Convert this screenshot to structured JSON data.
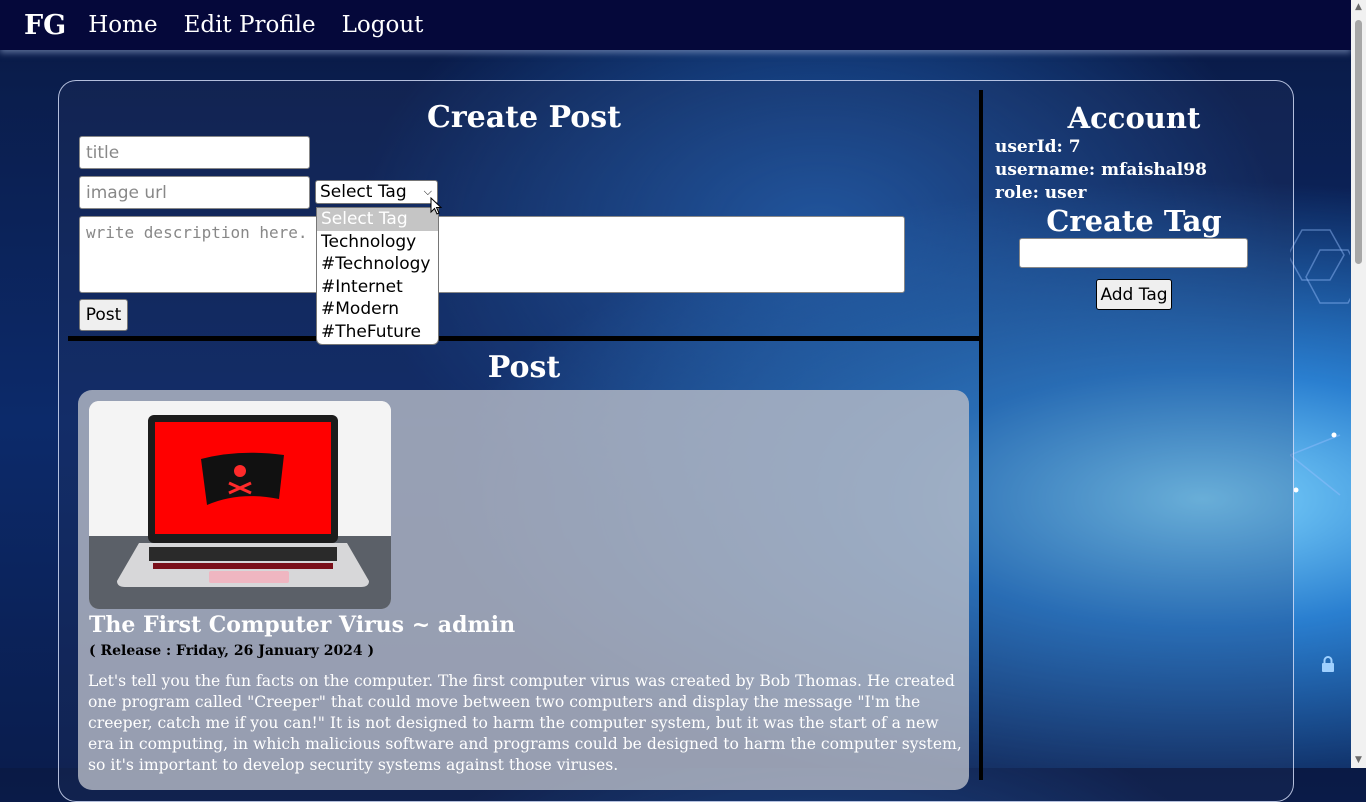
{
  "nav": {
    "brand": "FG",
    "links": [
      "Home",
      "Edit Profile",
      "Logout"
    ]
  },
  "create_post": {
    "title": "Create Post",
    "title_placeholder": "title",
    "image_placeholder": "image url",
    "description_placeholder": "write description here.",
    "tag_select": {
      "selected": "Select Tag",
      "options": [
        "Select Tag",
        "Technology",
        "#Technology",
        "#Internet",
        "#Modern",
        "#TheFuture"
      ]
    },
    "post_button": "Post"
  },
  "post_section": {
    "title": "Post",
    "post": {
      "heading": "The First Computer Virus ~ admin",
      "release": "( Release : Friday, 26 January 2024 )",
      "body": "Let's tell you the fun facts on the computer. The first computer virus was created by Bob Thomas. He created one program called \"Creeper\" that could move between two computers and display the message \"I'm the creeper, catch me if you can!\" It is not designed to harm the computer system, but it was the start of a new era in computing, in which malicious software and programs could be designed to harm the computer system, so it's important to develop security systems against those viruses."
    }
  },
  "account": {
    "title": "Account",
    "user_id": "userId: 7",
    "username": "username: mfaishal98",
    "role": "role: user"
  },
  "create_tag": {
    "title": "Create Tag",
    "button": "Add Tag"
  },
  "icons": [
    "mouse-cursor-icon",
    "scroll-up-arrow-icon",
    "scroll-down-arrow-icon",
    "dropdown-chevron-icon",
    "lock-icon"
  ],
  "colors": {
    "navbar": "#05083a",
    "post_card": "#b4bac6",
    "selected_option": "#c5c5c5"
  }
}
